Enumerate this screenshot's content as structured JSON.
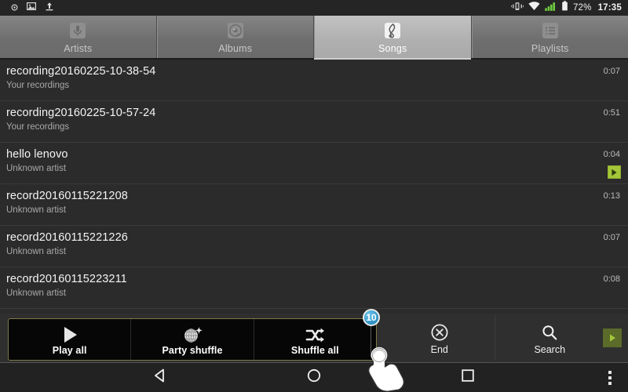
{
  "statusbar": {
    "left_icons": [
      "dot-icon",
      "image-icon",
      "upload-icon"
    ],
    "vibrate_icon": "vibrate-icon",
    "wifi_icon": "wifi-icon",
    "signal_icon": "signal-bars-icon",
    "battery_icon": "battery-icon",
    "battery_text": "72%",
    "clock": "17:35"
  },
  "tabs": [
    {
      "label": "Artists",
      "icon": "microphone-icon",
      "active": false
    },
    {
      "label": "Albums",
      "icon": "album-disc-icon",
      "active": false
    },
    {
      "label": "Songs",
      "icon": "treble-clef-icon",
      "active": true
    },
    {
      "label": "Playlists",
      "icon": "playlist-icon",
      "active": false
    }
  ],
  "songs": [
    {
      "title": "recording20160225-10-38-54",
      "subtitle": "Your recordings",
      "time": "0:07",
      "playing": false
    },
    {
      "title": "recording20160225-10-57-24",
      "subtitle": "Your recordings",
      "time": "0:51",
      "playing": false
    },
    {
      "title": "hello lenovo",
      "subtitle": "Unknown artist",
      "time": "0:04",
      "playing": true
    },
    {
      "title": "record20160115221208",
      "subtitle": "Unknown artist",
      "time": "0:13",
      "playing": false
    },
    {
      "title": "record20160115221226",
      "subtitle": "Unknown artist",
      "time": "0:07",
      "playing": false
    },
    {
      "title": "record20160115223211",
      "subtitle": "Unknown artist",
      "time": "0:08",
      "playing": false
    }
  ],
  "nowplaying": {
    "title": "hello lenovo",
    "subtitle": "Unknown artist",
    "play_icon": "play-icon"
  },
  "popup": {
    "items": [
      {
        "label": "Play all",
        "icon": "play-icon"
      },
      {
        "label": "Party shuffle",
        "icon": "disco-ball-icon"
      },
      {
        "label": "Shuffle all",
        "icon": "shuffle-icon"
      }
    ]
  },
  "bar_actions": [
    {
      "label": "End",
      "icon": "close-circle-icon"
    },
    {
      "label": "Search",
      "icon": "search-icon"
    }
  ],
  "tap_marker": {
    "number": "10",
    "cursor_icon": "hand-tap-cursor-icon"
  },
  "navbar": {
    "back_icon": "back-triangle-icon",
    "home_icon": "home-circle-icon",
    "recents_icon": "recents-square-icon",
    "overflow_icon": "overflow-dots-icon"
  },
  "colors": {
    "accent_green": "#a4c639",
    "badge_blue": "#2a8fc4",
    "popup_border": "#7b7a46",
    "list_bg": "#2b2b2b",
    "tab_active": "#b0b0b0"
  }
}
